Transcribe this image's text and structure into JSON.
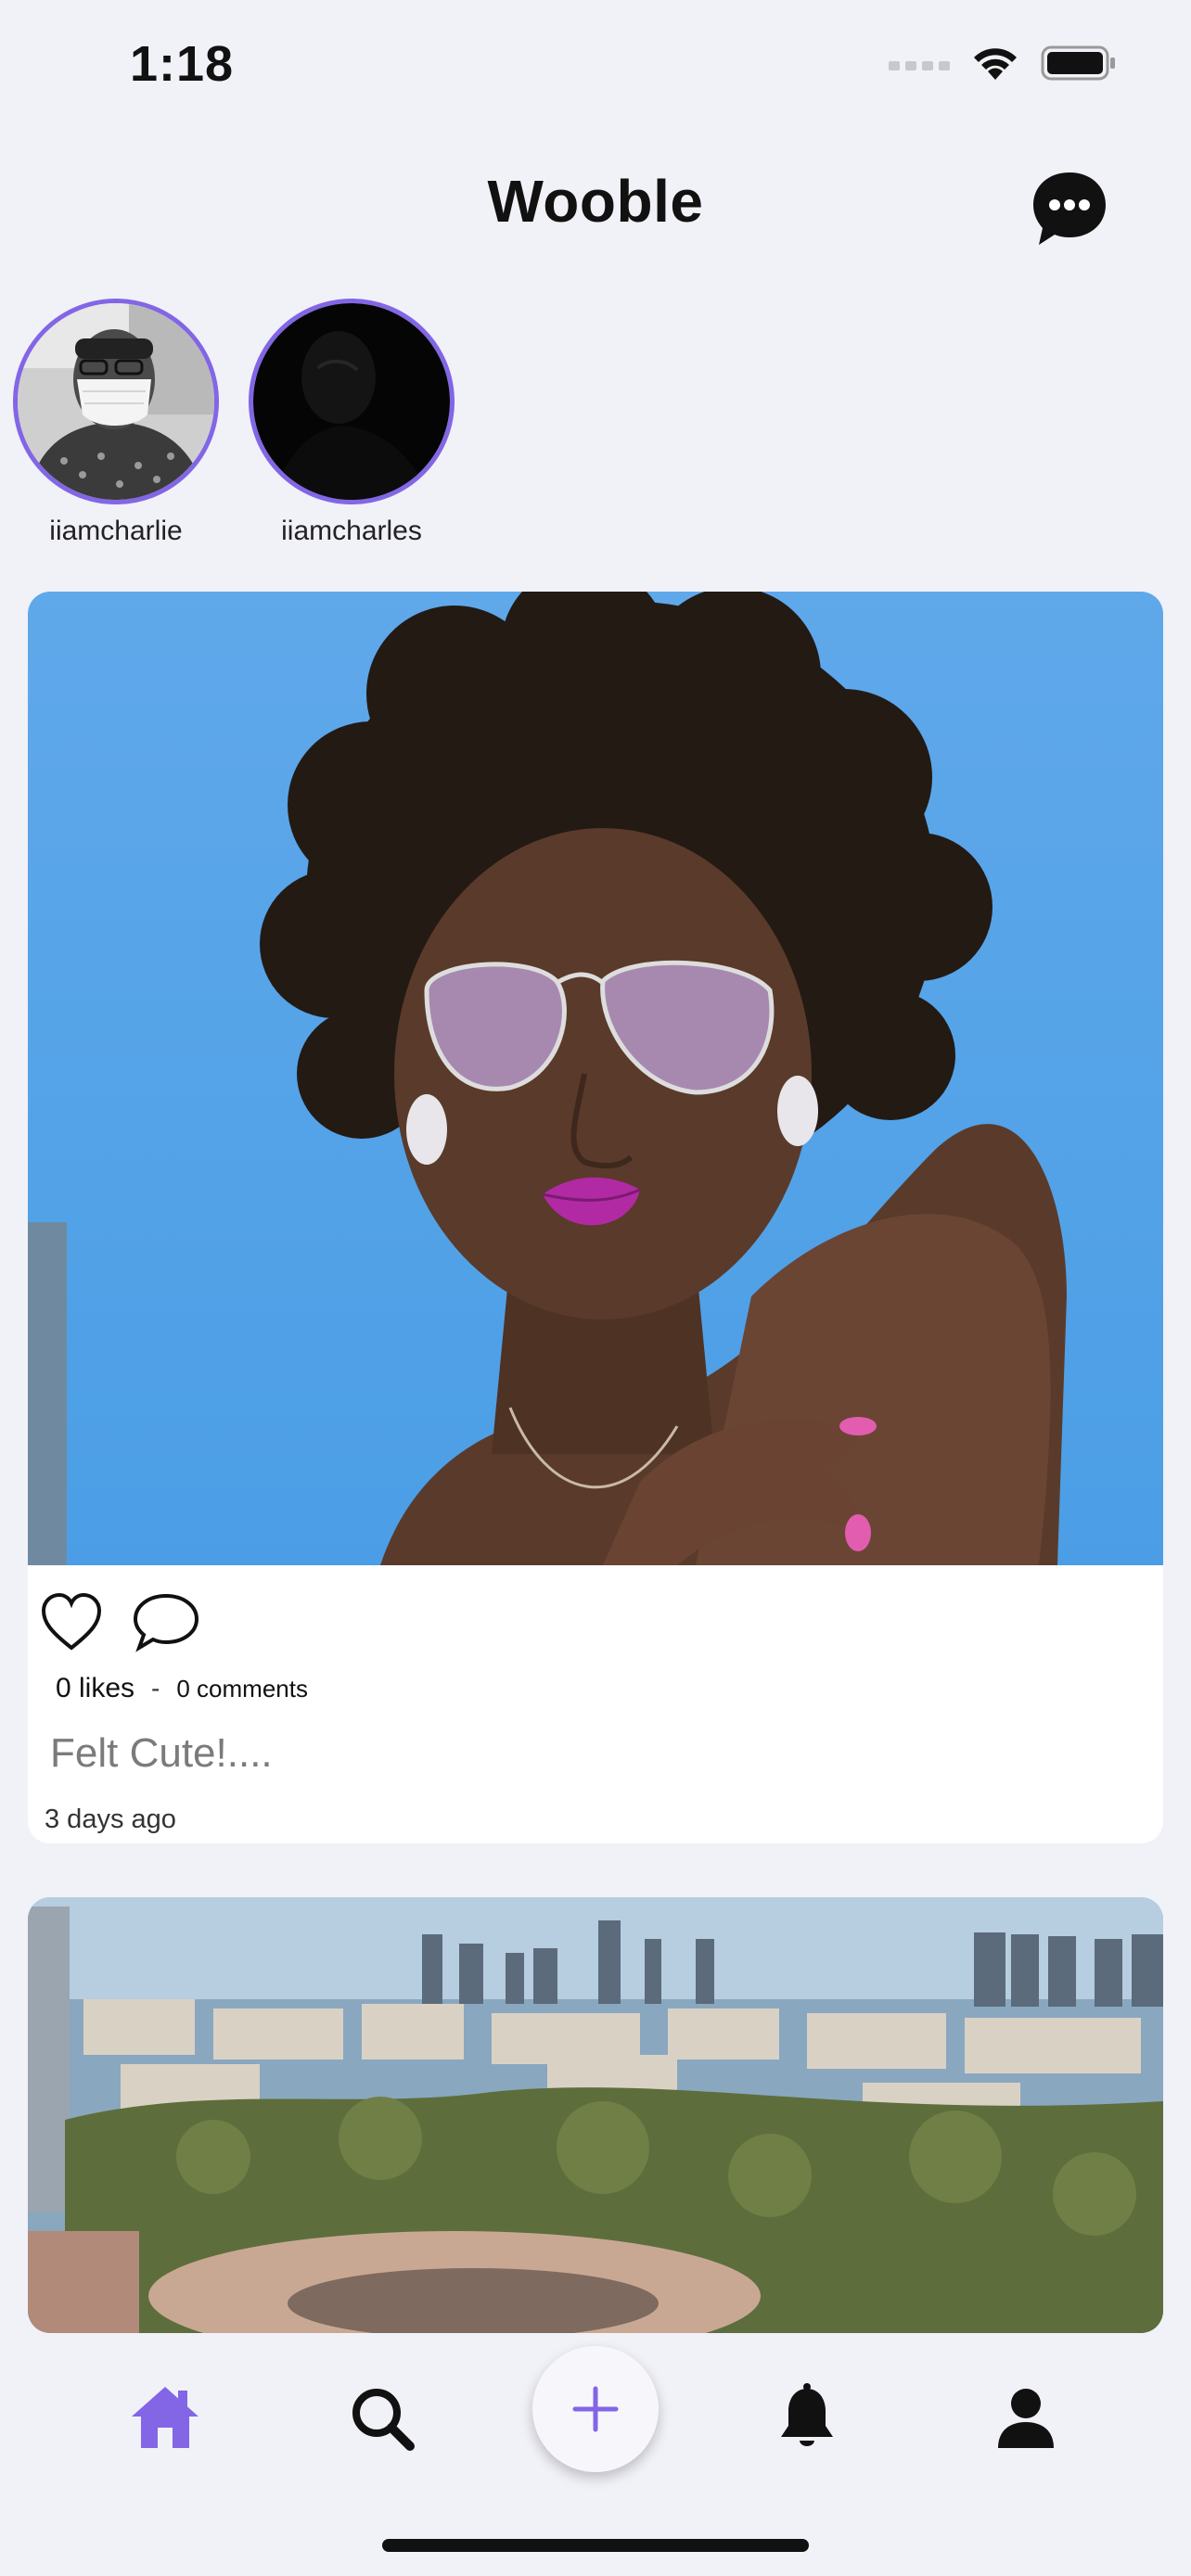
{
  "status_bar": {
    "time": "1:18"
  },
  "header": {
    "title": "Wooble"
  },
  "stories": [
    {
      "username": "iiamcharlie"
    },
    {
      "username": "iiamcharles"
    }
  ],
  "posts": [
    {
      "likes": "0 likes",
      "separator": "-",
      "comments": "0 comments",
      "caption": "Felt Cute!....",
      "time_ago": "3 days ago"
    }
  ],
  "icons": {
    "status": [
      "cellular-signal-icon",
      "wifi-icon",
      "battery-icon"
    ],
    "header": "chat-bubble-icon",
    "post_actions": [
      "heart-icon",
      "comment-icon"
    ],
    "nav": [
      "home-icon",
      "search-icon",
      "plus-icon",
      "bell-icon",
      "profile-icon"
    ]
  },
  "colors": {
    "accent": "#8266e6",
    "background": "#f1f1f8",
    "card": "#ffffff"
  }
}
